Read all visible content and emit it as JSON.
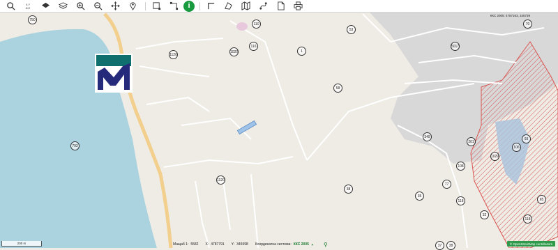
{
  "toolbar": {
    "items": [
      {
        "name": "search-icon",
        "glyph": "search"
      },
      {
        "name": "coordinates-button",
        "label_top": "X,Y",
        "label_bottom": "N,E"
      },
      {
        "name": "layers-icon",
        "glyph": "layers"
      },
      {
        "name": "layers-stack-icon",
        "glyph": "stack"
      },
      {
        "name": "zoom-in-icon",
        "glyph": "zoom-in"
      },
      {
        "name": "zoom-out-icon",
        "glyph": "zoom-out"
      },
      {
        "name": "pan-icon",
        "glyph": "pan"
      },
      {
        "name": "location-pin-icon",
        "glyph": "pin"
      },
      {
        "name": "select-area-icon",
        "glyph": "select"
      },
      {
        "name": "select-polygon-icon",
        "glyph": "select-poly"
      },
      {
        "name": "info-icon",
        "glyph": "i"
      },
      {
        "name": "measure-line-icon",
        "glyph": "line"
      },
      {
        "name": "measure-area-icon",
        "glyph": "area"
      },
      {
        "name": "map-icon",
        "glyph": "map"
      },
      {
        "name": "route-icon",
        "glyph": "route"
      },
      {
        "name": "document-icon",
        "glyph": "doc"
      },
      {
        "name": "print-icon",
        "glyph": "print"
      }
    ]
  },
  "top_readout": "ККС 2005: 4787163, 345739",
  "parcels": [
    "750",
    "110",
    "53",
    "1020",
    "116",
    "1",
    "1120",
    "5017",
    "58",
    "349",
    "201",
    "108",
    "93",
    "1029",
    "106",
    "77",
    "38",
    "35",
    "118",
    "32",
    "1120",
    "118",
    "37",
    "38",
    "70",
    "65"
  ],
  "water_label": "793",
  "scale_label": "200 m",
  "status": {
    "scale_label": "Мащаб 1:",
    "scale_value": "5582",
    "x_label": "X:",
    "x_value": "4787791",
    "y_label": "Y:",
    "y_value": "345598",
    "crs_label": "Координатна система:",
    "crs_value": "ККС 2005"
  },
  "attribution": "© OpenStreetMap contributors",
  "colors": {
    "water": "#abd3df",
    "land": "#efece6",
    "urban": "#d8d8d8",
    "road": "#ffffff",
    "main_road": "#f2cf8c",
    "hatch": "#d9534f",
    "accent": "#1a9a3f"
  }
}
